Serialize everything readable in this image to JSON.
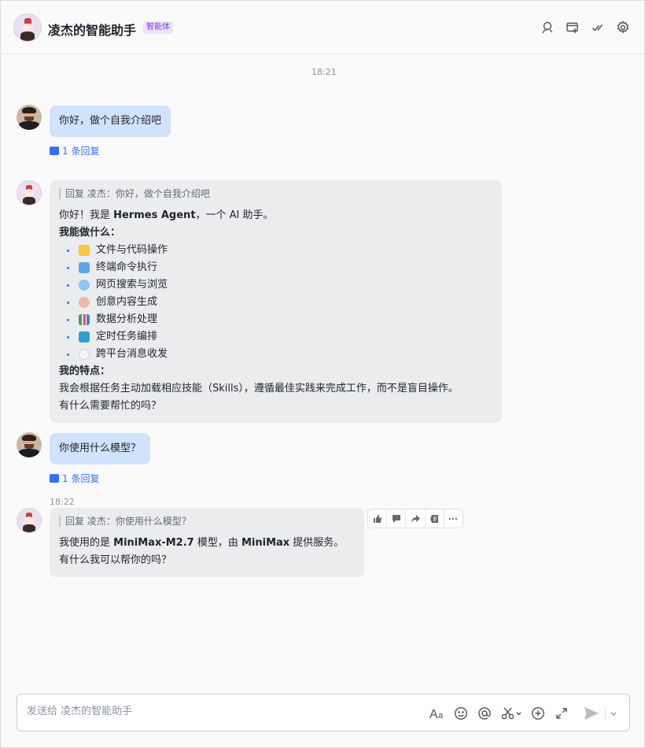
{
  "header": {
    "title": "凌杰的智能助手",
    "tag": "智能体",
    "icons": [
      "search-chat-icon",
      "add-to-sidebar-icon",
      "task-check-icon",
      "settings-gear-icon"
    ]
  },
  "timestamps": {
    "first": "18:21",
    "second": "18:22"
  },
  "messages": {
    "m1": {
      "text": "你好，做个自我介绍吧",
      "reply_link": "1 条回复"
    },
    "m2": {
      "quote": "回复 凌杰：你好，做个自我介绍吧",
      "intro_pre": "你好！我是 ",
      "intro_bold": "Hermes Agent",
      "intro_post": "，一个 AI 助手。",
      "can_do_heading": "我能做什么：",
      "features": [
        {
          "label": "文件与代码操作",
          "icon": "folder-icon",
          "color": "#f7c544"
        },
        {
          "label": "终端命令执行",
          "icon": "computer-icon",
          "color": "#5aa6e8"
        },
        {
          "label": "网页搜索与浏览",
          "icon": "globe-icon",
          "color": "#8ec5f0"
        },
        {
          "label": "创意内容生成",
          "icon": "palette-icon",
          "color": "#f0b7b0"
        },
        {
          "label": "数据分析处理",
          "icon": "bar-chart-icon",
          "color": "#3f9a6f"
        },
        {
          "label": "定时任务编排",
          "icon": "refresh-icon",
          "color": "#2ea0d6"
        },
        {
          "label": "跨平台消息收发",
          "icon": "speech-bubble-icon",
          "color": "#eef0f2"
        }
      ],
      "traits_heading": "我的特点：",
      "traits_text": "我会根据任务主动加载相应技能（Skills），遵循最佳实践来完成工作，而不是盲目操作。",
      "closing": "有什么需要帮忙的吗？"
    },
    "m3": {
      "text": "你使用什么模型？",
      "reply_link": "1 条回复"
    },
    "m4": {
      "quote": "回复 凌杰：你使用什么模型？",
      "line1_pre": "我使用的是 ",
      "line1_bold1": "MiniMax-M2.7",
      "line1_mid": " 模型，由 ",
      "line1_bold2": "MiniMax",
      "line1_post": " 提供服务。",
      "line2": "有什么我可以帮你的吗？"
    }
  },
  "message_toolbar": [
    "thumbs-up-icon",
    "reply-icon",
    "forward-icon",
    "pin-icon",
    "more-icon"
  ],
  "composer": {
    "placeholder": "发送给 凌杰的智能助手",
    "icons": [
      "font-format-icon",
      "emoji-icon",
      "mention-icon",
      "screenshot-icon",
      "add-icon",
      "expand-icon",
      "send-icon",
      "send-options-icon"
    ]
  }
}
